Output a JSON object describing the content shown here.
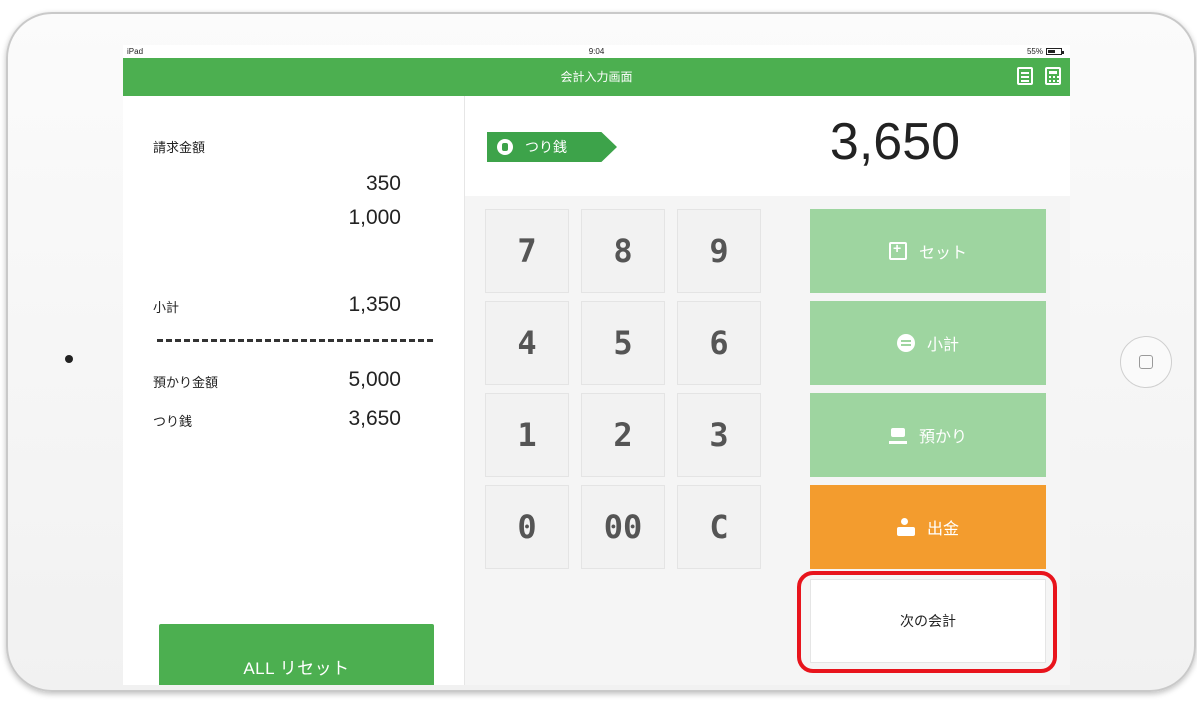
{
  "status_bar": {
    "device": "iPad",
    "time": "9:04",
    "battery": "55%"
  },
  "header": {
    "title": "会計入力画面",
    "list_icon": "list-icon",
    "calculator_icon": "calculator-icon"
  },
  "left_panel": {
    "billing_label": "請求金額",
    "billing_values": [
      "350",
      "1,000"
    ],
    "subtotal_label": "小計",
    "subtotal_value": "1,350",
    "deposit_label": "預かり金額",
    "deposit_value": "5,000",
    "change_label": "つり銭",
    "change_value": "3,650",
    "reset_button": "ALL リセット"
  },
  "display": {
    "tag_label": "つり銭",
    "amount": "3,650"
  },
  "keypad": [
    "7",
    "8",
    "9",
    "4",
    "5",
    "6",
    "1",
    "2",
    "3",
    "0",
    "00",
    "C"
  ],
  "actions": {
    "set": "セット",
    "subtotal": "小計",
    "deposit": "預かり",
    "withdraw": "出金",
    "next": "次の会計"
  },
  "colors": {
    "brand_green": "#4caf50",
    "light_green": "#9ed5a0",
    "orange": "#f39c2e",
    "highlight_red": "#e8141c"
  }
}
